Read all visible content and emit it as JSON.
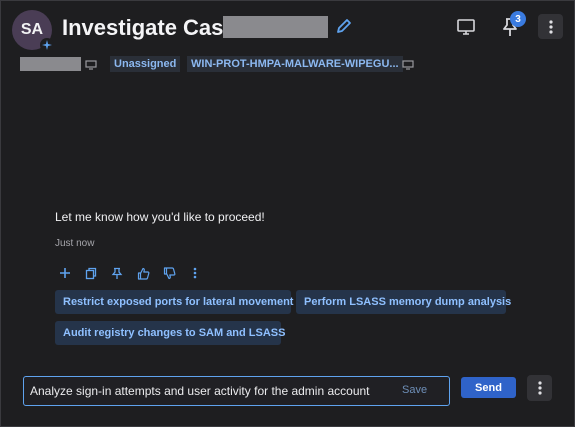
{
  "header": {
    "avatar_initials": "SA",
    "title": "Investigate Case",
    "notification_count": "3"
  },
  "subheader": {
    "assignee": "Unassigned",
    "host": "WIN-PROT-HMPA-MALWARE-WIPEGU..."
  },
  "message": {
    "text": "Let me know how you'd like to proceed!",
    "time": "Just now"
  },
  "suggestions": [
    "Restrict exposed ports for lateral movement",
    "Perform LSASS memory dump analysis",
    "Audit registry changes to SAM and LSASS"
  ],
  "composer": {
    "value": "Analyze sign-in attempts and user activity for the admin account",
    "save_label": "Save",
    "send_label": "Send"
  },
  "colors": {
    "background": "#1e1e20",
    "accent": "#2f63c9",
    "chip_text": "#8cb8f0",
    "suggestion_bg": "#25344a",
    "badge": "#3a7be0"
  },
  "icons": {
    "edit": "pencil-icon",
    "monitor": "monitor-icon",
    "pin": "pin-icon",
    "more": "more-vertical-icon",
    "actions": [
      "plus-icon",
      "copy-icon",
      "pin-icon",
      "thumbs-up-icon",
      "thumbs-down-icon",
      "more-vertical-icon"
    ]
  }
}
